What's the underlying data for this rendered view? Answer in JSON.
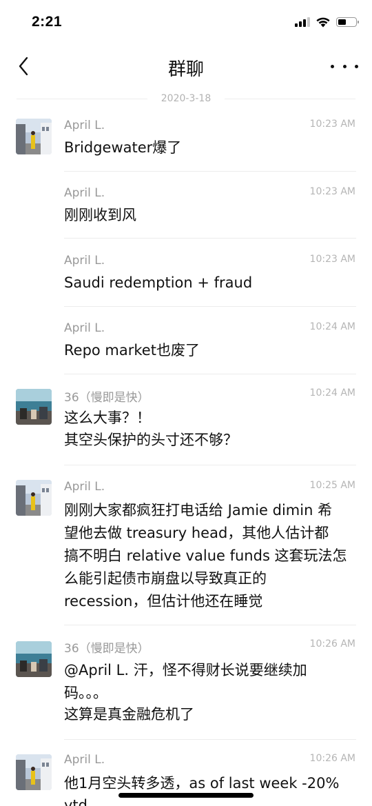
{
  "status_bar": {
    "time": "2:21"
  },
  "nav": {
    "title": "群聊"
  },
  "date_separator": "2020-3-18",
  "messages": [
    {
      "sender": "April L.",
      "time": "10:23 AM",
      "text": "Bridgewater爆了"
    },
    {
      "sender": "April L.",
      "time": "10:23 AM",
      "text": "刚刚收到风"
    },
    {
      "sender": "April L.",
      "time": "10:23 AM",
      "text": "Saudi redemption + fraud"
    },
    {
      "sender": "April L.",
      "time": "10:24 AM",
      "text": "Repo market也废了"
    },
    {
      "sender": "36（慢即是快）",
      "time": "10:24 AM",
      "text_lines": [
        "这么大事？！",
        "其空头保护的头寸还不够？"
      ]
    },
    {
      "sender": "April L.",
      "time": "10:25 AM",
      "text_lines": [
        "刚刚大家都疯狂打电话给 Jamie dimin 希",
        "望他去做 treasury head，其他人估计都",
        "搞不明白 relative value funds 这套玩法怎",
        "么能引起债市崩盘以导致真正的",
        "recession，但估计他还在睡觉"
      ]
    },
    {
      "sender": "36（慢即是快）",
      "time": "10:26 AM",
      "text_lines": [
        "@April L. 汗，怪不得财长说要继续加",
        "码。。。",
        "这算是真金融危机了"
      ]
    },
    {
      "sender": "April L.",
      "time": "10:26 AM",
      "text_lines": [
        "他1月空头转多透，as of last week -20%",
        "ytd"
      ]
    }
  ],
  "icons": {
    "back": "chevron-left-icon",
    "more": "more-dots-icon",
    "signal": "signal-icon",
    "wifi": "wifi-icon",
    "battery": "battery-icon"
  }
}
